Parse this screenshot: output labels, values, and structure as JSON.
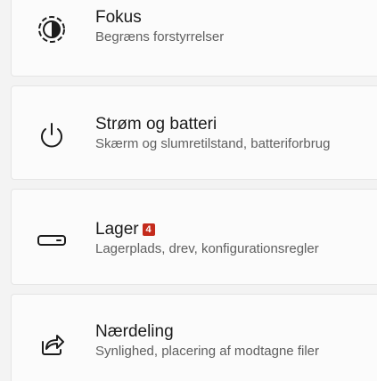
{
  "items": [
    {
      "icon": "focus-icon",
      "title": "Fokus",
      "subtitle": "Begræns forstyrrelser"
    },
    {
      "icon": "power-icon",
      "title": "Strøm og batteri",
      "subtitle": "Skærm og slumretilstand, batteriforbrug"
    },
    {
      "icon": "storage-icon",
      "title": "Lager",
      "badge": "4",
      "subtitle": "Lagerplads, drev, konfigurationsregler"
    },
    {
      "icon": "share-icon",
      "title": "Nærdeling",
      "subtitle": "Synlighed, placering af modtagne filer"
    }
  ],
  "colors": {
    "background": "#f3f3f3",
    "card": "#fbfbfb",
    "badge": "#c42b1c"
  }
}
